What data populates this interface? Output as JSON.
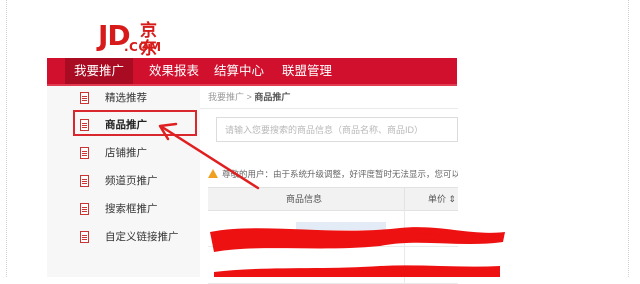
{
  "brand": {
    "logo_main": "JD",
    "logo_cn": "京东",
    "logo_com": ".COM",
    "color": "#d71b1b"
  },
  "topnav": {
    "items": [
      {
        "label": "我要推广",
        "active": true
      },
      {
        "label": "效果报表",
        "active": false
      },
      {
        "label": "结算中心",
        "active": false
      },
      {
        "label": "联盟管理",
        "active": false
      }
    ],
    "background": "#d1102e"
  },
  "sidebar": {
    "items": [
      {
        "label": "精选推荐",
        "active": false
      },
      {
        "label": "商品推广",
        "active": true
      },
      {
        "label": "店铺推广",
        "active": false
      },
      {
        "label": "频道页推广",
        "active": false
      },
      {
        "label": "搜索框推广",
        "active": false
      },
      {
        "label": "自定义链接推广",
        "active": false
      }
    ]
  },
  "breadcrumb": {
    "parent": "我要推广",
    "separator": ">",
    "current": "商品推广"
  },
  "search": {
    "placeholder": "请输入您要搜索的商品信息（商品名称、商品ID）"
  },
  "notice": {
    "text": "尊敬的用户：由于系统升级调整，好评度暂时无法显示，您可以到商"
  },
  "table": {
    "columns": [
      "商品信息",
      "单价 ⇕"
    ]
  },
  "annotation": {
    "arrow_color": "#e02020",
    "scribble_color": "#ee1111"
  }
}
